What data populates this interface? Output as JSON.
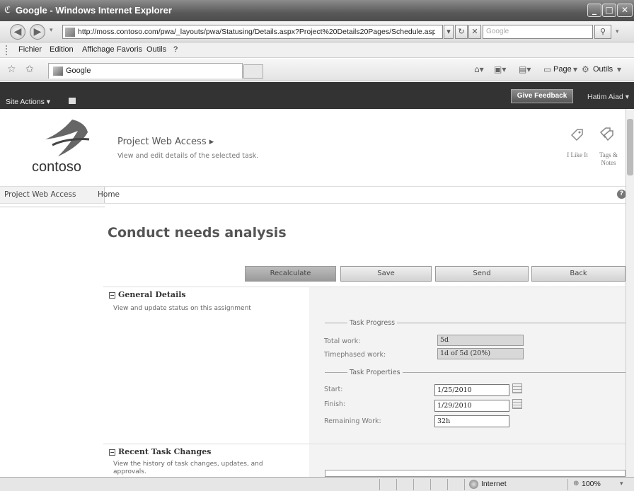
{
  "window": {
    "title": "Google - Windows Internet Explorer"
  },
  "address": {
    "url": "http://moss.contoso.com/pwa/_layouts/pwa/Statusing/Details.aspx?Project%20Details20Pages/Schedule.aspx?",
    "search_placeholder": "Google"
  },
  "menu": [
    "Fichier",
    "Edition",
    "Affichage",
    "Favoris",
    "Outils",
    "?"
  ],
  "favbar": {
    "tab_title": "Google",
    "page_label": "Page",
    "tools_label": "Outils"
  },
  "sp_ribbon": {
    "site_actions": "Site Actions",
    "feedback": "Give Feedback",
    "user": "Hatim Aiad"
  },
  "header": {
    "logo_text": "contoso",
    "site_title": "Project Web Access",
    "site_description": "View and edit details of the selected task.",
    "like_label": "I Like It",
    "tags_label_1": "Tags &",
    "tags_label_2": "Notes"
  },
  "topnav": {
    "item1": "Project Web Access",
    "item2": "Home"
  },
  "page": {
    "title": "Conduct needs analysis"
  },
  "actions": [
    "Recalculate",
    "Save",
    "Send",
    "Back"
  ],
  "general": {
    "heading": "General Details",
    "description": "View and update status on this assignment"
  },
  "task_progress": {
    "legend": "Task Progress",
    "total_work_label": "Total work:",
    "total_work": "5d",
    "timephased_label": "Timephased work:",
    "timephased": "1d of 5d (20%)"
  },
  "task_properties": {
    "legend": "Task Properties",
    "start_label": "Start:",
    "start": "1/25/2010",
    "finish_label": "Finish:",
    "finish": "1/29/2010",
    "remaining_label": "Remaining Work:",
    "remaining": "32h"
  },
  "recent": {
    "heading": "Recent Task Changes",
    "description": "View the history of task changes, updates, and approvals."
  },
  "status": {
    "zone": "Internet",
    "zoom": "100%"
  }
}
